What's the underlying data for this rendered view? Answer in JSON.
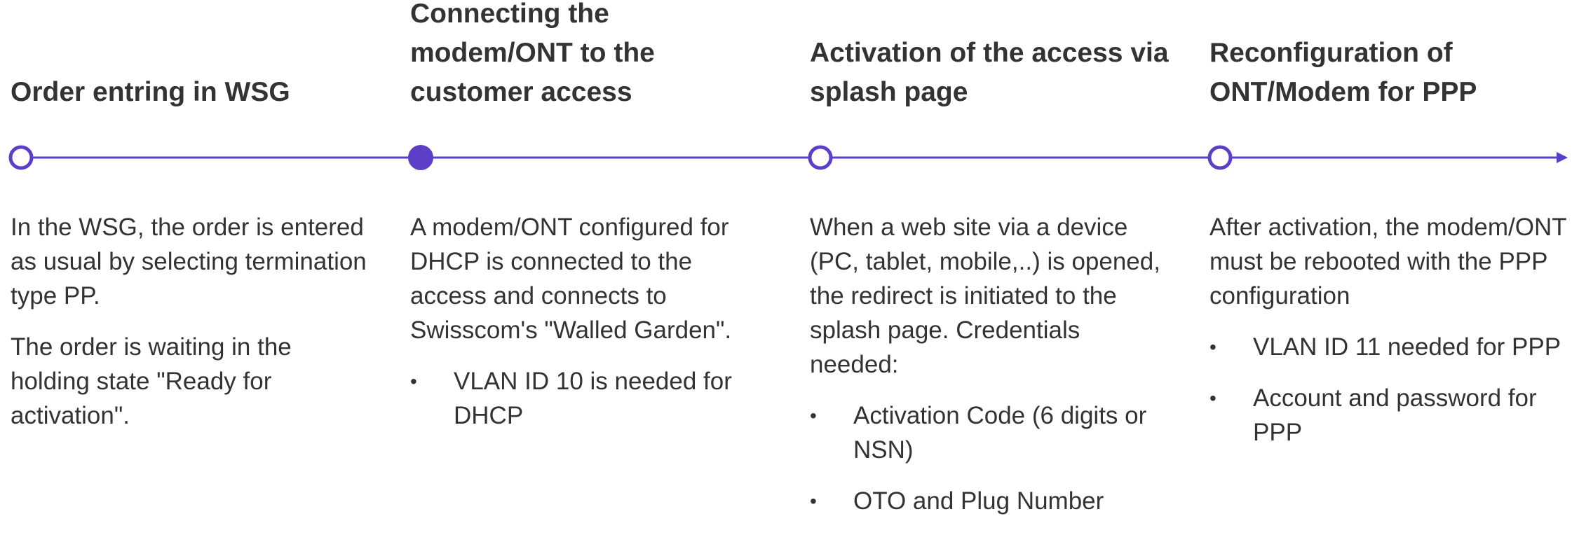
{
  "colors": {
    "accent": "#5b3fc8",
    "text": "#333333"
  },
  "steps": [
    {
      "title": "Order entring in WSG",
      "marker": "open",
      "paragraphs": [
        "In the WSG, the order is entered as usual by selecting termination type PP.",
        "The order is waiting in the holding state \"Ready for activation\"."
      ],
      "bullets": []
    },
    {
      "title": "Connecting the modem/ONT to the customer access",
      "marker": "filled",
      "paragraphs": [
        "A modem/ONT configured for DHCP is connected to the access and connects to Swisscom's \"Walled Garden\"."
      ],
      "bullets": [
        "VLAN ID 10 is needed for DHCP"
      ]
    },
    {
      "title": "Activation of the access via splash page",
      "marker": "open",
      "paragraphs": [
        "When a web site via a device (PC, tablet, mobile,..) is opened, the redirect is initiated to the splash page. Credentials needed:"
      ],
      "bullets": [
        "Activation Code (6 digits or NSN)",
        "OTO and Plug Number"
      ]
    },
    {
      "title": "Reconfiguration of ONT/Modem for PPP",
      "marker": "open",
      "paragraphs": [
        "After activation, the modem/ONT must be rebooted with the PPP configuration"
      ],
      "bullets": [
        "VLAN ID 11 needed for PPP",
        "Account and password  for PPP"
      ]
    }
  ],
  "bullet_glyph": "•"
}
